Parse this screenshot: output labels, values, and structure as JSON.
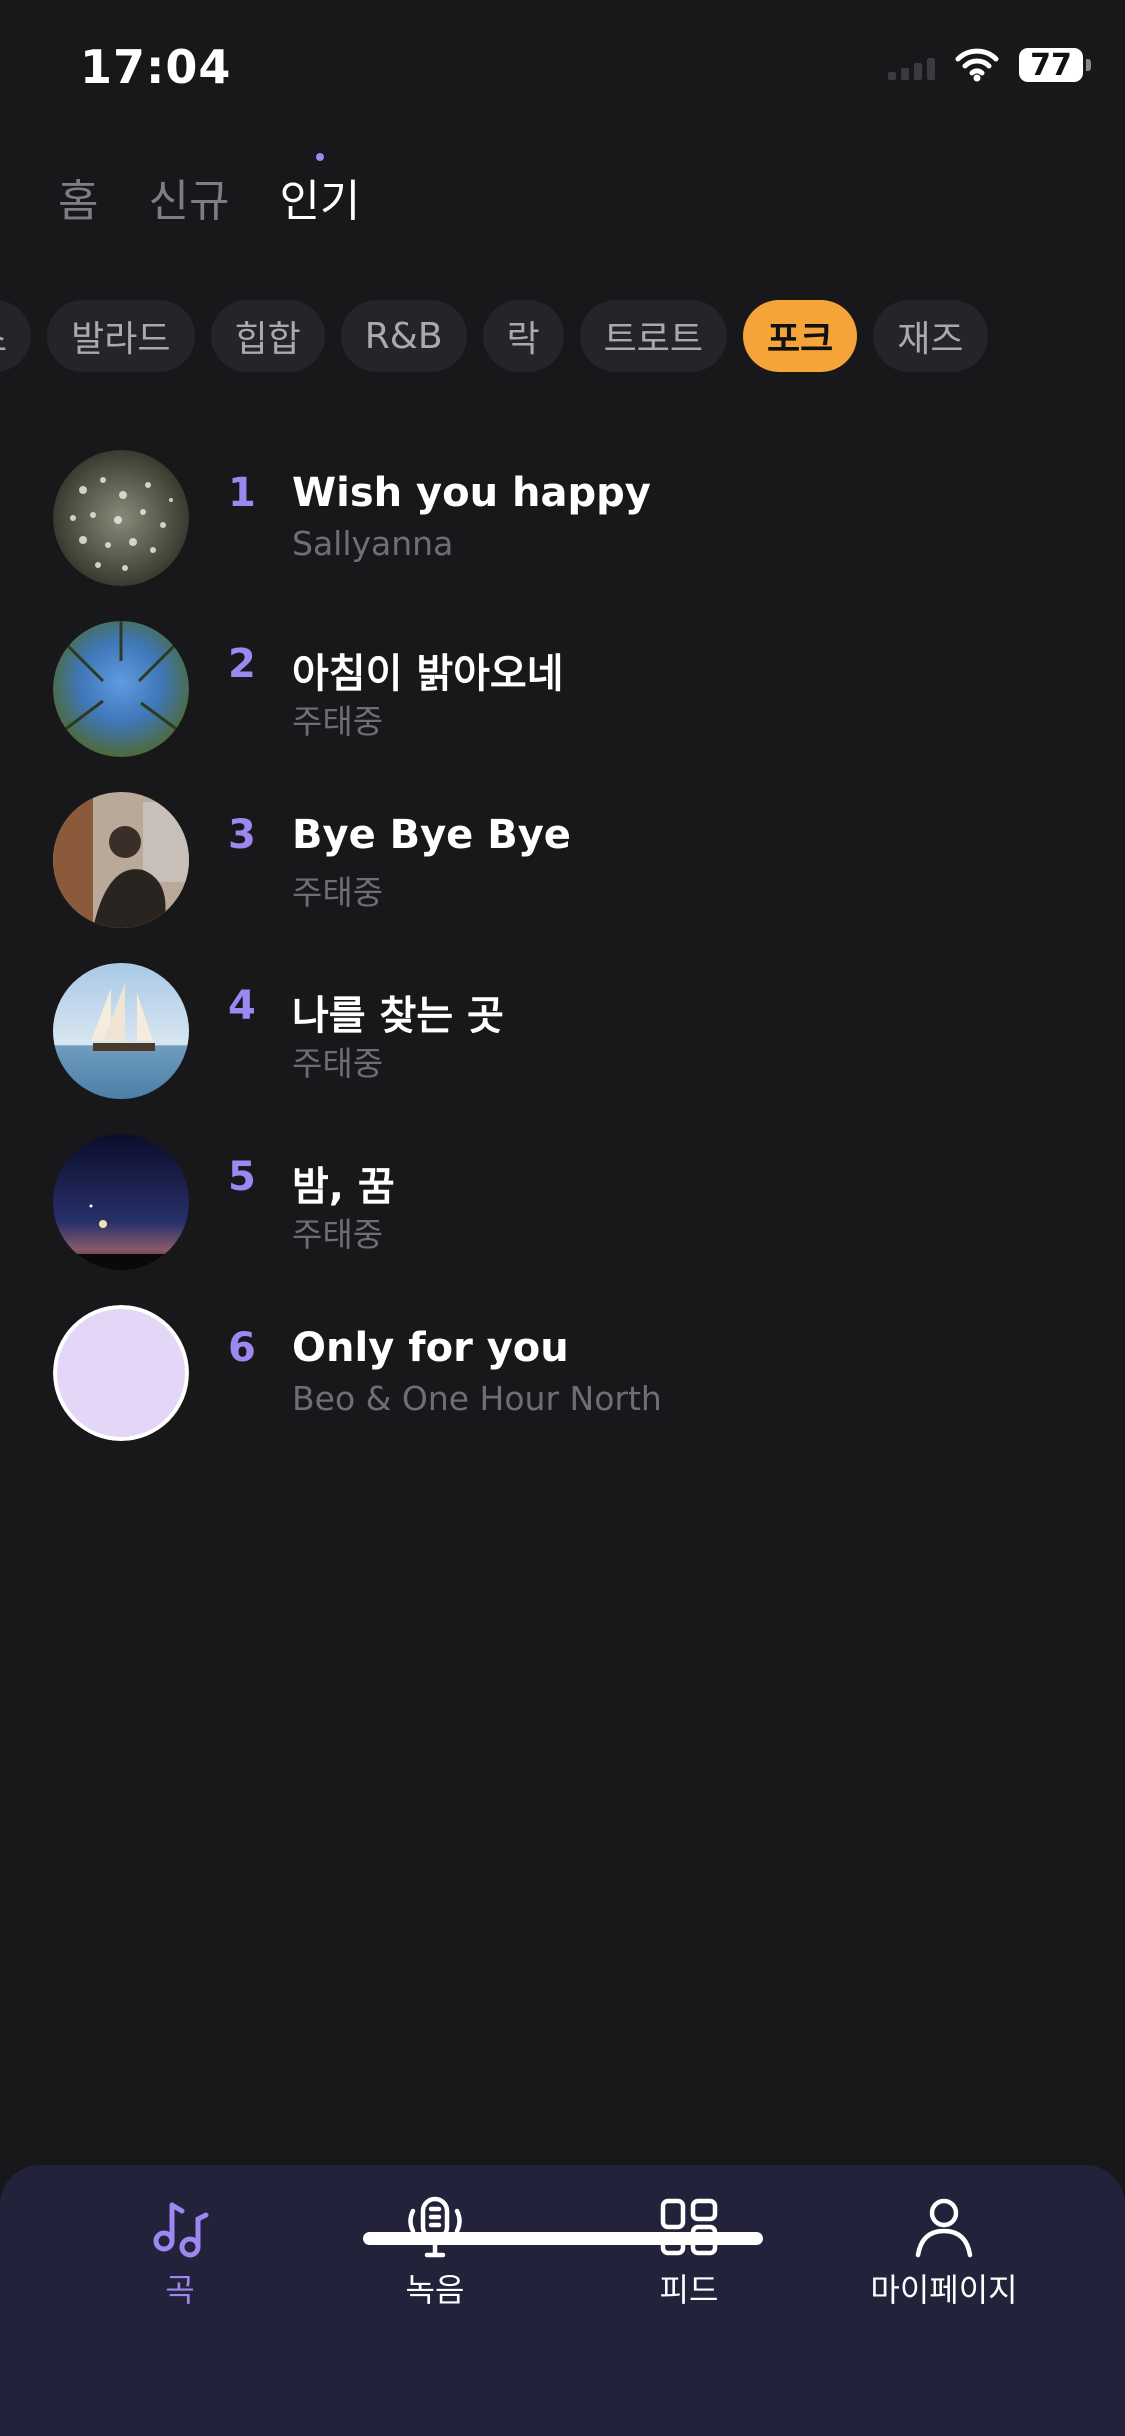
{
  "status": {
    "time": "17:04",
    "battery": "77"
  },
  "top_tabs": [
    {
      "label": "홈",
      "active": false
    },
    {
      "label": "신규",
      "active": false
    },
    {
      "label": "인기",
      "active": true
    }
  ],
  "genres": [
    {
      "label": "스",
      "active": false
    },
    {
      "label": "발라드",
      "active": false
    },
    {
      "label": "힙합",
      "active": false
    },
    {
      "label": "R&B",
      "active": false
    },
    {
      "label": "락",
      "active": false
    },
    {
      "label": "트로트",
      "active": false
    },
    {
      "label": "포크",
      "active": true
    },
    {
      "label": "재즈",
      "active": false
    }
  ],
  "songs": [
    {
      "rank": "1",
      "title": "Wish you happy",
      "artist": "Sallyanna"
    },
    {
      "rank": "2",
      "title": "아침이 밝아오네",
      "artist": "주태중"
    },
    {
      "rank": "3",
      "title": "Bye Bye Bye",
      "artist": "주태중"
    },
    {
      "rank": "4",
      "title": "나를 찾는 곳",
      "artist": "주태중"
    },
    {
      "rank": "5",
      "title": "밤, 꿈",
      "artist": "주태중"
    },
    {
      "rank": "6",
      "title": "Only for you",
      "artist": "Beo & One Hour North"
    }
  ],
  "bottom_nav": [
    {
      "label": "곡",
      "icon": "music-note-icon",
      "active": true
    },
    {
      "label": "녹음",
      "icon": "microphone-icon",
      "active": false
    },
    {
      "label": "피드",
      "icon": "grid-icon",
      "active": false
    },
    {
      "label": "마이페이지",
      "icon": "person-icon",
      "active": false
    }
  ],
  "colors": {
    "accent": "#9d87f0",
    "chip_active": "#f5a43a",
    "background": "#18181b",
    "nav_background": "#22223a"
  }
}
